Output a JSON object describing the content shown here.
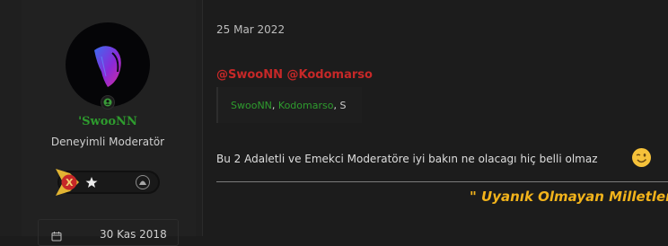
{
  "user": {
    "username": "'SwooNN",
    "title": "Deneyimli Moderatör",
    "join_date": "30 Kas 2018"
  },
  "post": {
    "date": "25 Mar 2022",
    "mention_line": "@SwooNN @Kodomarso",
    "quote": {
      "user1": "SwooNN",
      "sep1": ",",
      "user2": "Kodomarso",
      "sep2": ", ",
      "trail": "S"
    },
    "message": "Bu 2 Adaletli ve Emekci Moderatöre iyi bakın ne olacagı hiç belli olmaz",
    "signature": "\" Uyanık Olmayan Milletler,"
  },
  "colors": {
    "username": "#2e9c2e",
    "mention": "#c62828",
    "signature": "#f2b31b",
    "online": "#3a9a3a"
  },
  "icons": {
    "online": "user-online-icon",
    "calendar": "calendar-icon",
    "emoji": "wink-emoji-icon"
  }
}
